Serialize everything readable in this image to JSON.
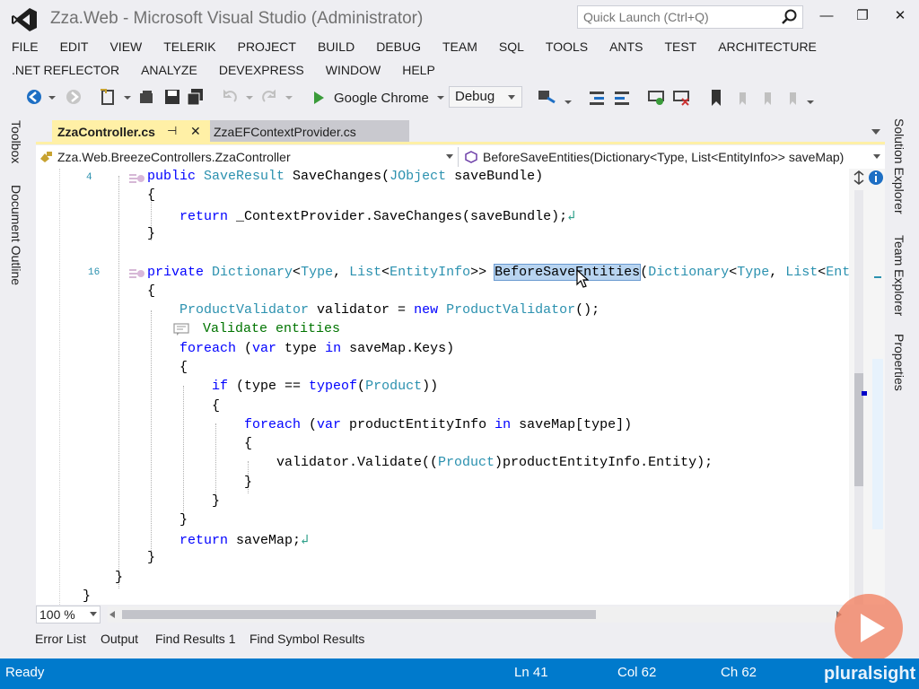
{
  "window": {
    "title": "Zza.Web - Microsoft Visual Studio (Administrator)",
    "quick_launch_placeholder": "Quick Launch (Ctrl+Q)"
  },
  "menu": {
    "row1": [
      "FILE",
      "EDIT",
      "VIEW",
      "TELERIK",
      "PROJECT",
      "BUILD",
      "DEBUG",
      "TEAM",
      "SQL",
      "TOOLS",
      "ANTS",
      "TEST",
      "ARCHITECTURE"
    ],
    "row2": [
      ".NET REFLECTOR",
      "ANALYZE",
      "DEVEXPRESS",
      "WINDOW",
      "HELP"
    ]
  },
  "toolbar": {
    "run_target": "Google Chrome",
    "config": "Debug"
  },
  "left_panels": [
    "Toolbox",
    "Document Outline"
  ],
  "right_panels": [
    "Solution Explorer",
    "Team Explorer",
    "Properties"
  ],
  "tabs": {
    "active": "ZzaController.cs",
    "inactive": "ZzaEFContextProvider.cs",
    "pin_glyph": "⊣",
    "close_glyph": "✕"
  },
  "navbar": {
    "class_path": "Zza.Web.BreezeControllers.ZzaController",
    "member": "BeforeSaveEntities(Dictionary<Type, List<EntityInfo>> saveMap)"
  },
  "code": {
    "ref_count_1": "4",
    "ref_count_2": "16",
    "region_label": "Validate entities"
  },
  "bottom": {
    "zoom": "100 %",
    "tabs": [
      "Error List",
      "Output",
      "Find Results 1",
      "Find Symbol Results"
    ]
  },
  "status": {
    "state": "Ready",
    "line": "Ln 41",
    "col": "Col 62",
    "ch": "Ch 62",
    "brand": "pluralsight"
  },
  "colors": {
    "accent": "#007acc",
    "active_tab": "#fff0a6",
    "keyword": "#0000ff",
    "type": "#2b91af"
  }
}
